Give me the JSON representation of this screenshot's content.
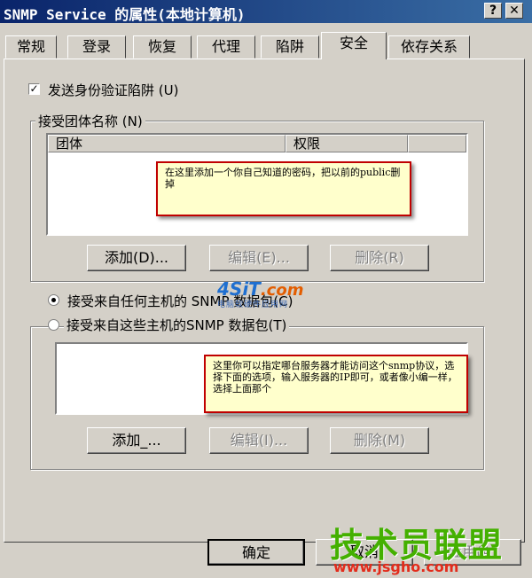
{
  "window": {
    "title": "SNMP Service 的属性(本地计算机)",
    "help_glyph": "?",
    "close_glyph": "✕"
  },
  "tabs": [
    "常规",
    "登录",
    "恢复",
    "代理",
    "陷阱",
    "安全",
    "依存关系"
  ],
  "active_tab": "安全",
  "security": {
    "send_auth_trap": {
      "label": "发送身份验证陷阱 (U)",
      "checked": true,
      "check_glyph": "✓"
    },
    "community_group": {
      "title": "接受团体名称 (N)",
      "columns": [
        "团体",
        "权限"
      ],
      "rows": [],
      "buttons": {
        "add": "添加(D)...",
        "edit": "编辑(E)...",
        "remove": "删除(R)"
      }
    },
    "hosts": {
      "any_host_label": "接受来自任何主机的 SNMP 数据包(C)",
      "these_hosts_label": "接受来自这些主机的SNMP 数据包(T)",
      "selected": "any",
      "rows": [],
      "buttons": {
        "add": "添加_...",
        "edit": "编辑(I)...",
        "remove": "删除(M)"
      }
    }
  },
  "annotations": {
    "note1": "在这里添加一个你自己知道的密码，把以前的public删掉",
    "note2": "这里你可以指定哪台服务器才能访问这个snmp协议，选择下面的选项，输入服务器的IP即可，或者像小编一样，选择上面那个"
  },
  "footer": {
    "ok": "确定",
    "cancel": "取消",
    "apply": "应用(A)"
  },
  "watermarks": {
    "site1_main": "4SiT",
    "site1_suffix": ".com",
    "site1_sub": "电脑软硬件应用网",
    "site2_main": "技术员联盟",
    "site2_url": "www.jsgho.com"
  },
  "colors": {
    "titlebar": "#0a246a",
    "dialog": "#d4d0c8",
    "note_bg": "#ffffcc",
    "note_border": "#c00000"
  }
}
